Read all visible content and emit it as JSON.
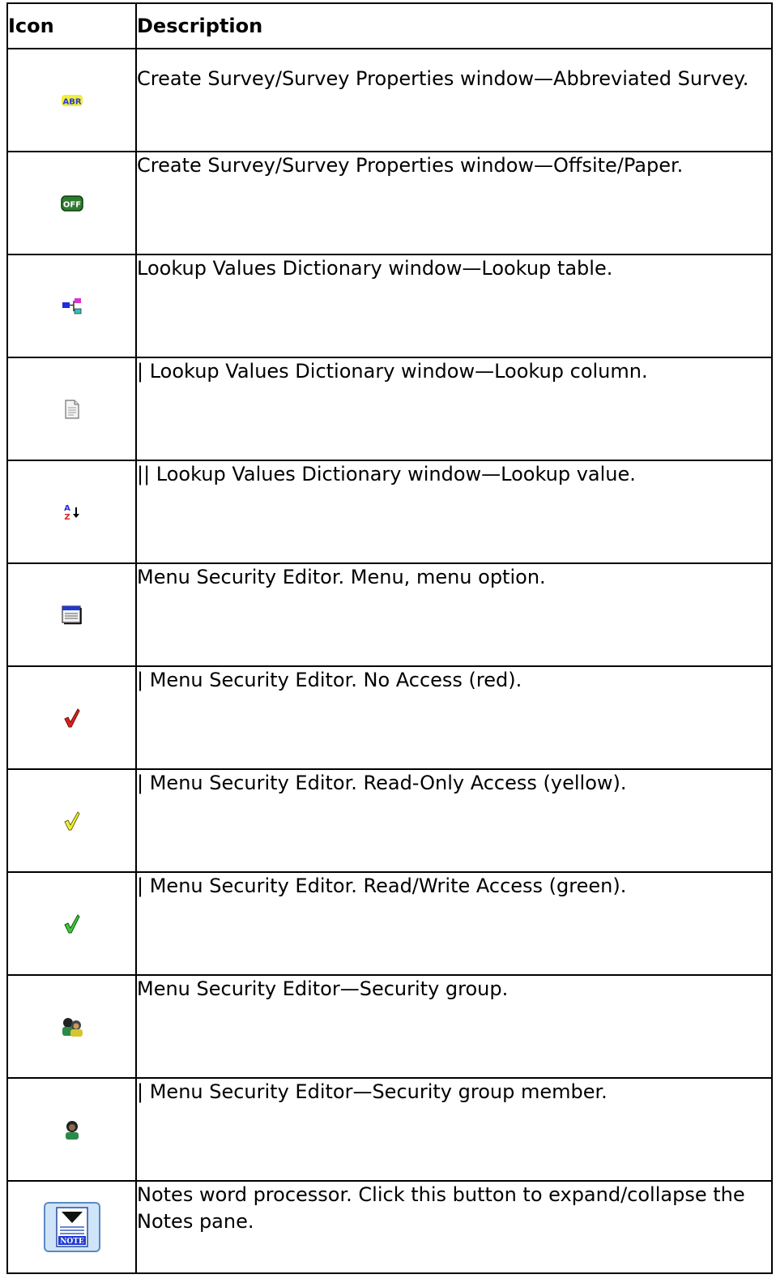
{
  "table": {
    "headers": {
      "icon": "Icon",
      "description": "Description"
    },
    "rows": [
      {
        "icon": "abbreviated-survey-icon",
        "description": "Create Survey/Survey Properties window—Abbreviated Survey."
      },
      {
        "icon": "offsite-paper-icon",
        "description": "Create Survey/Survey Properties window—Offsite/Paper."
      },
      {
        "icon": "lookup-table-icon",
        "description": "Lookup Values Dictionary window—Lookup table."
      },
      {
        "icon": "lookup-column-icon",
        "description": "| Lookup Values Dictionary window—Lookup column."
      },
      {
        "icon": "lookup-value-icon",
        "description": "|| Lookup Values Dictionary window—Lookup value."
      },
      {
        "icon": "menu-icon",
        "description": "Menu Security Editor. Menu, menu option."
      },
      {
        "icon": "red-checkmark-icon",
        "description": "| Menu Security Editor. No Access (red)."
      },
      {
        "icon": "yellow-checkmark-icon",
        "description": "| Menu Security Editor. Read-Only Access (yellow)."
      },
      {
        "icon": "green-checkmark-icon",
        "description": "| Menu Security Editor. Read/Write Access (green)."
      },
      {
        "icon": "security-group-icon",
        "description": "Menu Security Editor—Security group."
      },
      {
        "icon": "security-group-member-icon",
        "description": "| Menu Security Editor—Security group member."
      },
      {
        "icon": "notes-button-icon",
        "description": "Notes word processor. Click this button to expand/collapse the Notes pane."
      }
    ]
  },
  "icon_labels": {
    "abbreviated": "ABR",
    "offsite": "OFF",
    "notes": "NOTE"
  },
  "colors": {
    "red": "#e0201c",
    "yellow": "#f2ee3a",
    "green": "#3ccc3c"
  }
}
